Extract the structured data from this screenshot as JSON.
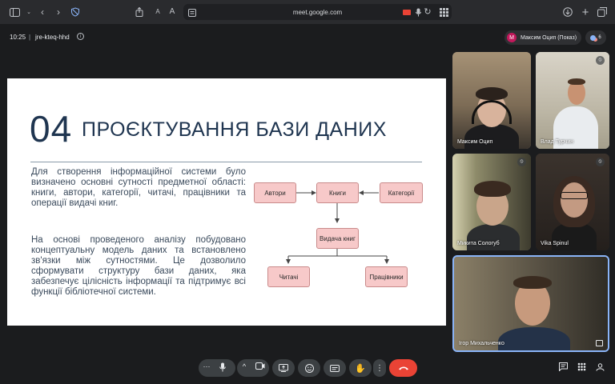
{
  "browser": {
    "url": "meet.google.com",
    "text_size_small": "A",
    "text_size_large": "A"
  },
  "meeting": {
    "time": "10:25",
    "separator": "|",
    "code": "jre-kteq-hhd",
    "presenter_initial": "M",
    "presenter_label": "Максим Оцип (Показ)",
    "participant_count": "6"
  },
  "slide": {
    "number": "04",
    "title": "ПРОЄКТУВАННЯ БАЗИ ДАНИХ",
    "paragraph1": "Для створення інформаційної системи було визначено основні сутності предметної області: книги, автори, категорії, читачі, працівники та операції видачі книг.",
    "paragraph2": "На основі проведеного аналізу побудовано концептуальну модель даних та встановлено зв'язки між сутностями. Це дозволило сформувати структуру бази даних, яка забезпечує цілісність інформації та підтримує всі функції бібліотечної системи.",
    "diagram": {
      "authors": "Автори",
      "books": "Книги",
      "categories": "Категорії",
      "issue": "Видача книг",
      "readers": "Читачі",
      "staff": "Працівники"
    }
  },
  "participants": [
    {
      "name": "Максим Оцип"
    },
    {
      "name": "Влад Турчин"
    },
    {
      "name": "Микита Сологуб"
    },
    {
      "name": "Vika Spinul"
    },
    {
      "name": "Ігор Михальченко"
    }
  ],
  "colors": {
    "end_call": "#ea4335",
    "slide_text": "#1f3550",
    "node_fill": "#f7c9c9",
    "active_speaker_border": "#8ab4f8"
  }
}
